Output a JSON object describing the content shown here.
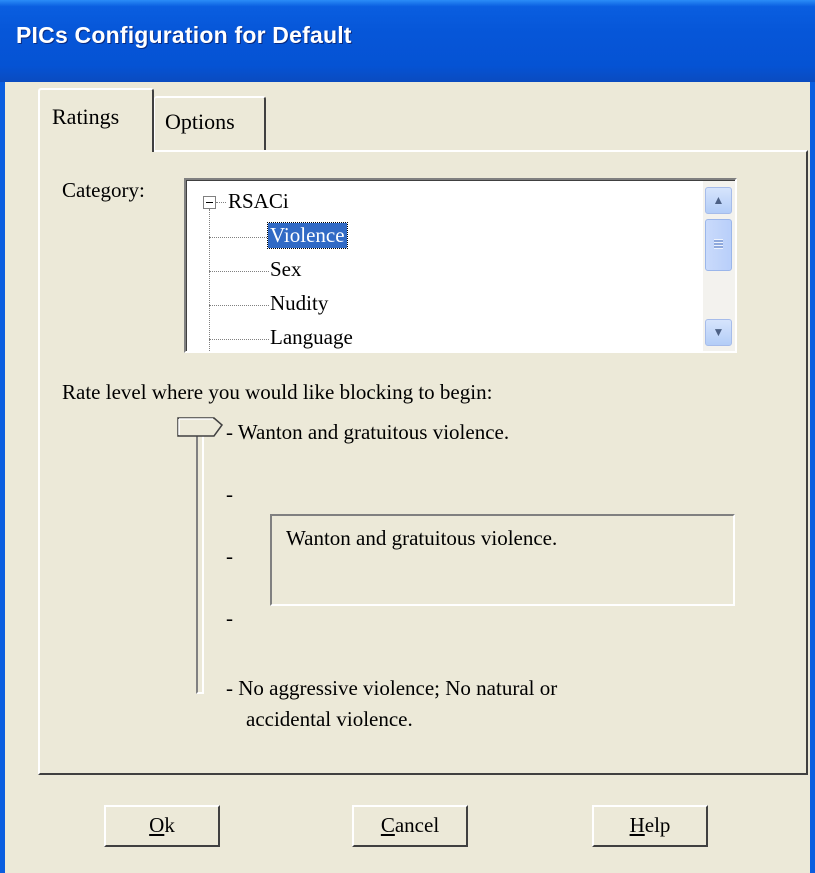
{
  "window": {
    "title": "PICs Configuration for Default"
  },
  "tabs": [
    {
      "label": "Ratings",
      "active": true
    },
    {
      "label": "Options",
      "active": false
    }
  ],
  "category": {
    "label": "Category:",
    "tree": {
      "root": "RSACi",
      "items": [
        "Violence",
        "Sex",
        "Nudity",
        "Language"
      ],
      "selected": "Violence"
    }
  },
  "rating": {
    "prompt": "Rate level where you would like blocking to begin:",
    "levels": [
      {
        "label": "-  Wanton and gratuitous violence."
      },
      {
        "label": "-"
      },
      {
        "label": "-"
      },
      {
        "label": "-"
      },
      {
        "label": "- No aggressive violence; No natural or",
        "label2": "accidental violence."
      }
    ],
    "level_count": 5,
    "selected_level": 4,
    "description": "Wanton and gratuitous violence."
  },
  "buttons": {
    "ok": {
      "mnemonic": "O",
      "rest": "k"
    },
    "cancel": {
      "mnemonic": "C",
      "rest": "ancel"
    },
    "help": {
      "mnemonic": "H",
      "rest": "elp"
    }
  },
  "colors": {
    "titlebar": "#0656d8",
    "selection": "#316ac5",
    "face": "#ece9d8"
  }
}
